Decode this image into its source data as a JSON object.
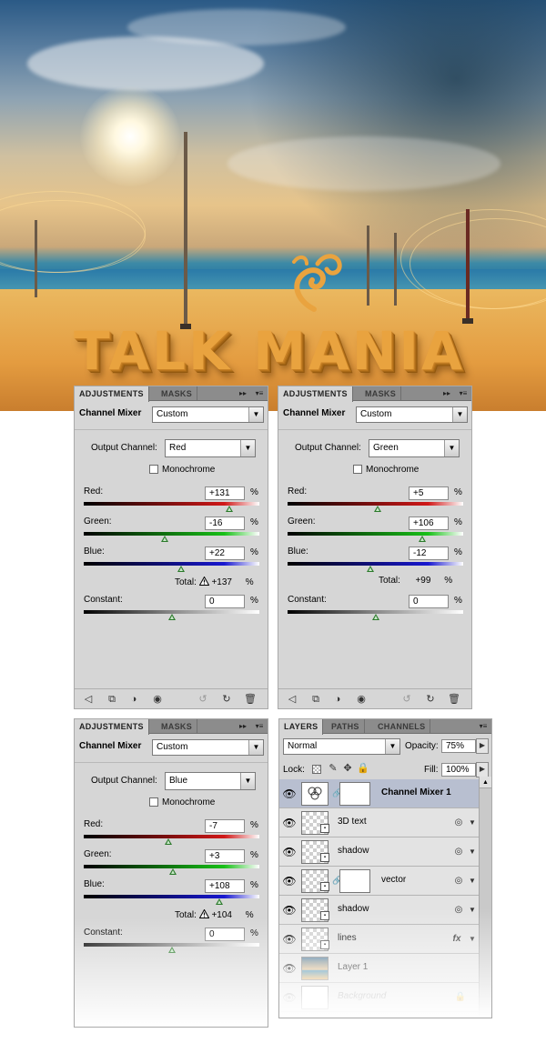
{
  "hero": {
    "title": "TALK MANIA",
    "colors": {
      "sky": "#2b5a86",
      "sun": "#fff8e0",
      "sea": "#2a7aa8",
      "sand": "#e49c40",
      "text": "#e9a33f"
    }
  },
  "adjust_panels": [
    {
      "tabs": {
        "active": "ADJUSTMENTS",
        "inactive": "MASKS",
        "more": "▸▸",
        "menu": "▾≡"
      },
      "title": "Channel Mixer",
      "preset": "Custom",
      "output_label": "Output Channel:",
      "output_channel": "Red",
      "monochrome_label": "Monochrome",
      "sliders": [
        {
          "label": "Red:",
          "value": "+131",
          "pct": "%",
          "num": 131
        },
        {
          "label": "Green:",
          "value": "-16",
          "pct": "%",
          "num": -16
        },
        {
          "label": "Blue:",
          "value": "+22",
          "pct": "%",
          "num": 22
        }
      ],
      "total_label": "Total:",
      "total_value": "+137",
      "total_pct": "%",
      "total_warning": true,
      "constant": {
        "label": "Constant:",
        "value": "0",
        "pct": "%",
        "num": 0
      },
      "footer": true
    },
    {
      "tabs": {
        "active": "ADJUSTMENTS",
        "inactive": "MASKS",
        "more": "▸▸",
        "menu": "▾≡"
      },
      "title": "Channel Mixer",
      "preset": "Custom",
      "output_label": "Output Channel:",
      "output_channel": "Green",
      "monochrome_label": "Monochrome",
      "sliders": [
        {
          "label": "Red:",
          "value": "+5",
          "pct": "%",
          "num": 5
        },
        {
          "label": "Green:",
          "value": "+106",
          "pct": "%",
          "num": 106
        },
        {
          "label": "Blue:",
          "value": "-12",
          "pct": "%",
          "num": -12
        }
      ],
      "total_label": "Total:",
      "total_value": "+99",
      "total_pct": "%",
      "total_warning": false,
      "constant": {
        "label": "Constant:",
        "value": "0",
        "pct": "%",
        "num": 0
      },
      "footer": true
    },
    {
      "tabs": {
        "active": "ADJUSTMENTS",
        "inactive": "MASKS",
        "more": "▸▸",
        "menu": "▾≡"
      },
      "title": "Channel Mixer",
      "preset": "Custom",
      "output_label": "Output Channel:",
      "output_channel": "Blue",
      "monochrome_label": "Monochrome",
      "sliders": [
        {
          "label": "Red:",
          "value": "-7",
          "pct": "%",
          "num": -7
        },
        {
          "label": "Green:",
          "value": "+3",
          "pct": "%",
          "num": 3
        },
        {
          "label": "Blue:",
          "value": "+108",
          "pct": "%",
          "num": 108
        }
      ],
      "total_label": "Total:",
      "total_value": "+104",
      "total_pct": "%",
      "total_warning": true,
      "constant": {
        "label": "Constant:",
        "value": "0",
        "pct": "%",
        "num": 0
      },
      "footer": false
    }
  ],
  "slider_colors": {
    "red": "#d01818",
    "green": "#18c018",
    "blue": "#1818d0",
    "constant": "#ffffff"
  },
  "layers": {
    "tabs": [
      "LAYERS",
      "PATHS",
      "CHANNELS"
    ],
    "menu": "▾≡",
    "blend_mode": "Normal",
    "opacity_label": "Opacity:",
    "opacity": "75%",
    "lock_label": "Lock:",
    "fill_label": "Fill:",
    "fill": "100%",
    "rows": [
      {
        "name": "Channel Mixer 1",
        "type": "adjustment",
        "selected": true,
        "icon": ""
      },
      {
        "name": "3D text",
        "type": "smart",
        "selected": false,
        "icon": "smart-filter-icon"
      },
      {
        "name": "shadow",
        "type": "smart",
        "selected": false,
        "icon": "smart-filter-icon"
      },
      {
        "name": "vector",
        "type": "smart-mask",
        "selected": false,
        "icon": "smart-filter-icon"
      },
      {
        "name": "shadow",
        "type": "smart",
        "selected": false,
        "icon": "smart-filter-icon"
      },
      {
        "name": "lines",
        "type": "smart",
        "selected": false,
        "icon": "fx-icon",
        "fx": "fx"
      },
      {
        "name": "Layer 1",
        "type": "image",
        "selected": false,
        "icon": ""
      },
      {
        "name": "Background",
        "type": "background",
        "selected": false,
        "icon": "lock-icon"
      }
    ]
  }
}
